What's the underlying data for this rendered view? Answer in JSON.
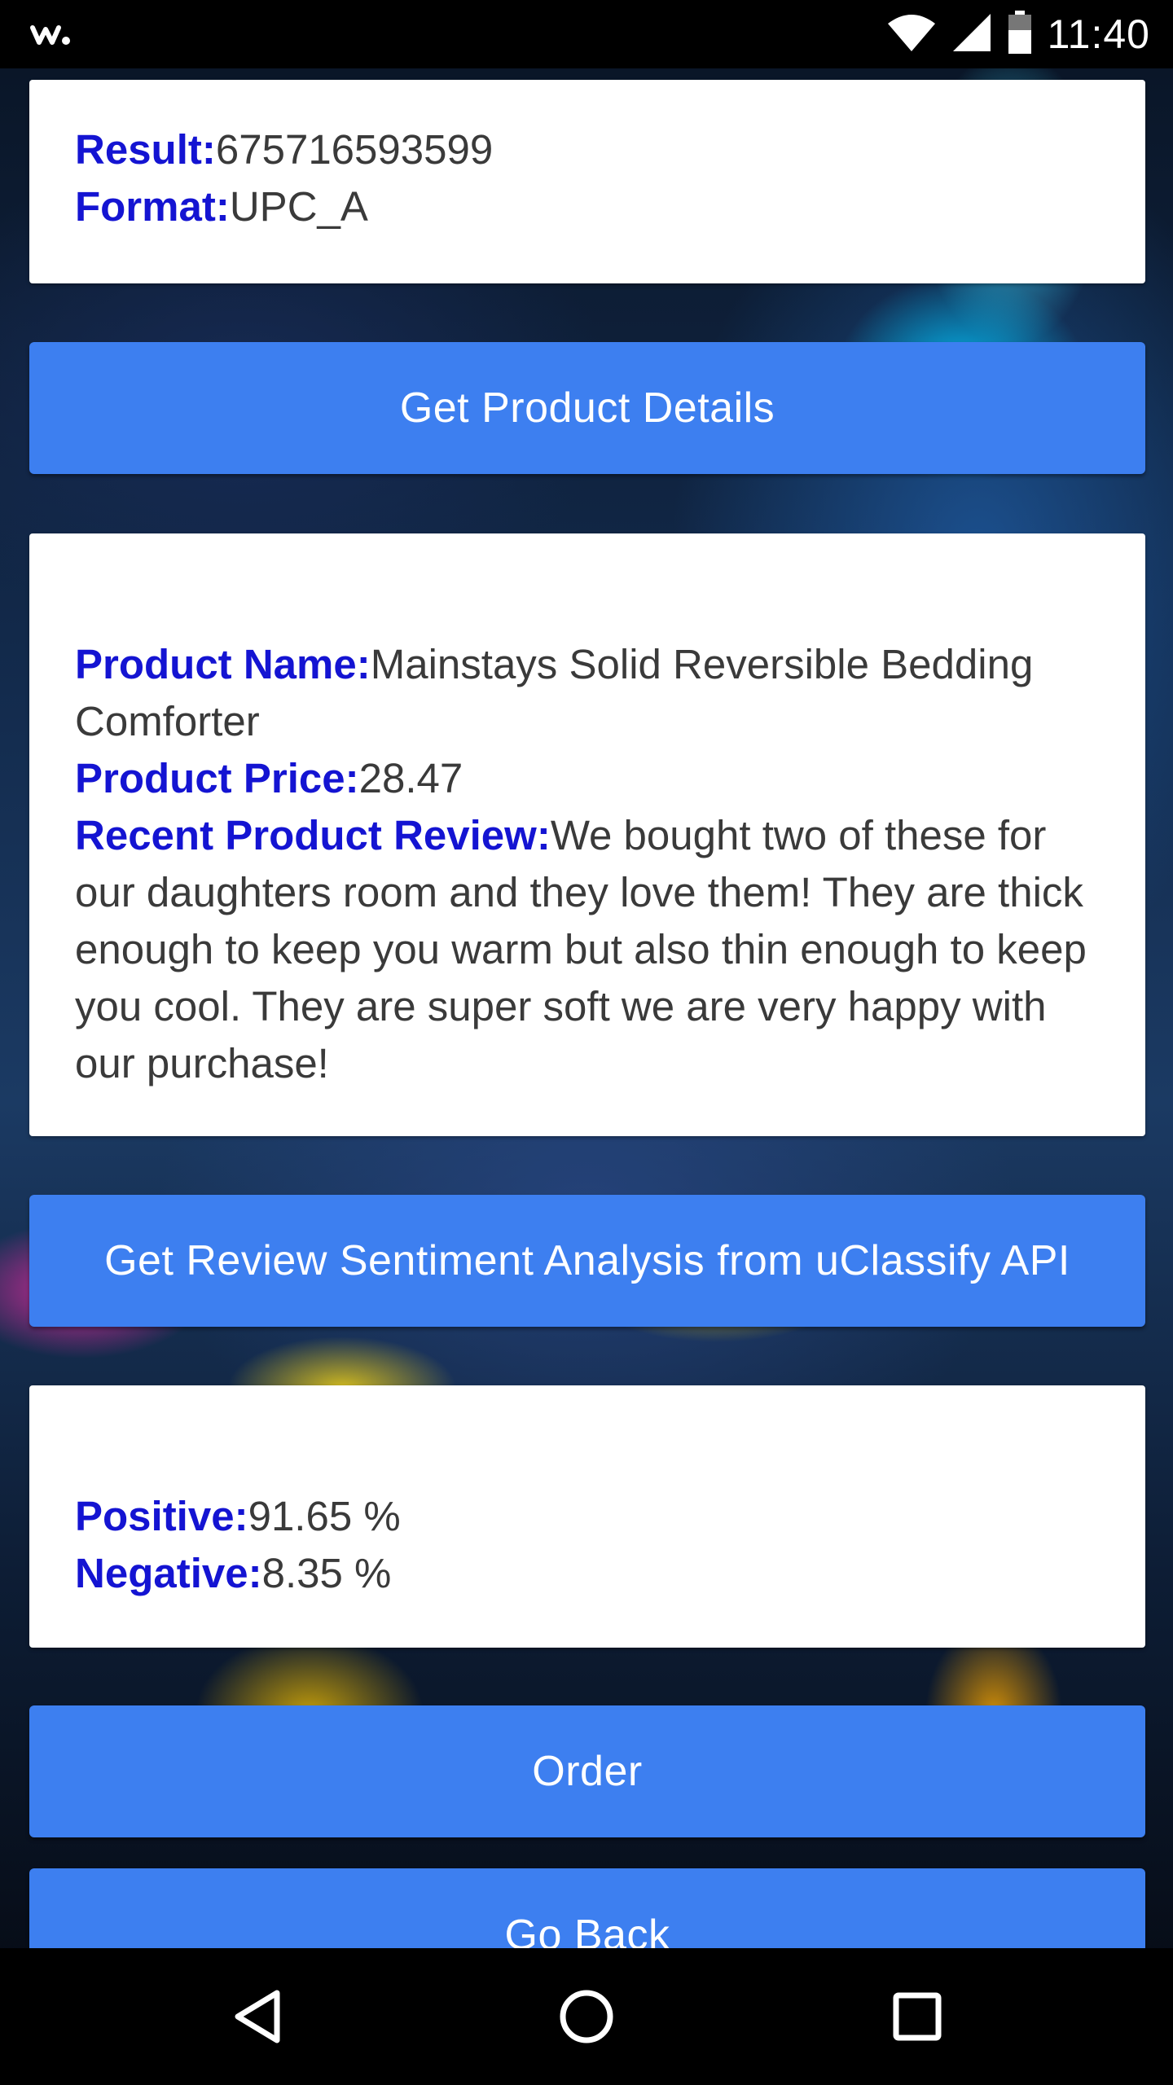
{
  "status_bar": {
    "time": "11:40",
    "left_icon": "walkman-icon",
    "icons": [
      "wifi-icon",
      "signal-icon",
      "battery-icon"
    ]
  },
  "barcode": {
    "result_label": "Result:",
    "result_value": "675716593599",
    "format_label": "Format:",
    "format_value": "UPC_A"
  },
  "get_product_button": "Get Product Details",
  "product": {
    "name_label": "Product Name:",
    "name_value": "Mainstays Solid Reversible Bedding Comforter",
    "price_label": "Product Price:",
    "price_value": "28.47",
    "review_label": "Recent Product Review:",
    "review_value": "We bought two of these for our daughters room and they love them! They are thick enough to keep you warm but also thin enough to keep you cool. They are super soft we are very happy with our purchase!"
  },
  "sentiment_button": "Get Review Sentiment Analysis from uClassify API",
  "sentiment": {
    "positive_label": "Positive:",
    "positive_value": "91.65 %",
    "negative_label": "Negative:",
    "negative_value": "8.35 %"
  },
  "order_button": "Order",
  "go_back_button": "Go Back",
  "nav": {
    "back": "back-triangle-icon",
    "home": "home-circle-icon",
    "recents": "recents-square-icon"
  },
  "colors": {
    "accent": "#3d7ff0",
    "label": "#1414d2"
  }
}
